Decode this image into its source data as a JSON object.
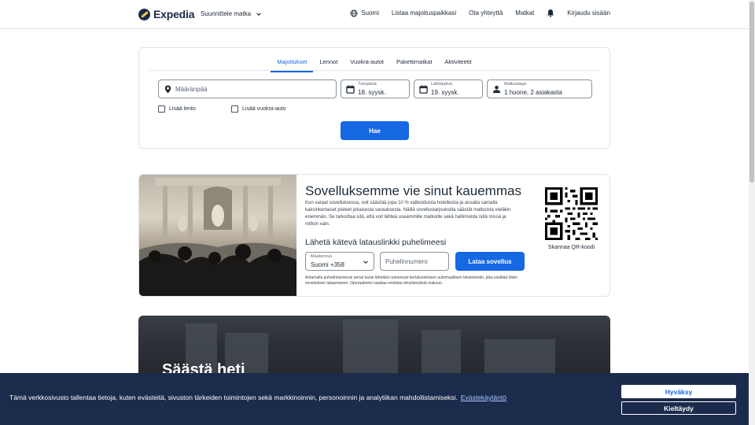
{
  "header": {
    "logo_text": "Expedia",
    "plan_trip": "Suunnittele matka",
    "nav": {
      "language": "Suomi",
      "list_property": "Listaa majoituspaikkasi",
      "contact": "Ota yhteyttä",
      "trips": "Matkat",
      "sign_in": "Kirjaudu sisään"
    }
  },
  "search": {
    "tabs": [
      "Majoitukset",
      "Lennot",
      "Vuokra-autot",
      "Pakettimatkat",
      "Aktiviteetit"
    ],
    "active_tab": "Majoitukset",
    "destination_placeholder": "Määränpää",
    "checkin_label": "Tulopäivä",
    "checkin_value": "18. syysk.",
    "checkout_label": "Lähtöpäivä",
    "checkout_value": "19. syysk.",
    "travelers_label": "Matkustajat",
    "travelers_value": "1 huone, 2 asiakasta",
    "add_flight": "Lisää lento",
    "add_car": "Lisää vuokra-auto",
    "search_button": "Hae"
  },
  "promo": {
    "title": "Sovelluksemme vie sinut kauemmas",
    "text": "Kun varaat sovelluksessa, voit säästää jopa 10 % valikoiduista hotelleista ja ansaita samalla kaksinkertaiset pisteet jokaisesta varauksesta. Näillä sovellustarjouksilla säästät matkoista vieläkin enemmän. Se tarkoittaa sitä, että voit lähteä useammille matkoille sekä hallinnoida niitä missä ja milloin vain.",
    "subtitle": "Lähetä kätevä latauslinkki puhelimeesi",
    "country_label": "Maatunnus",
    "country_value": "Suomi +358",
    "phone_placeholder": "Puhelinnumero",
    "download_button": "Lataa sovellus",
    "disclaimer": "Antamalla puhelinnumerosi annat luvan lähettää numeroosi kertaluonteisen automaattisen tekstiviestin, joka sisältää linkin sovelluksen lataamiseen. Operaattorisi saattaa veloittaa tekstiviestistä maksun.",
    "qr_label": "Skannaa QR-koodi"
  },
  "save_banner": {
    "title": "Säästä heti"
  },
  "cookie": {
    "text": "Tämä verkkosivusto tallentaa tietoja, kuten evästeitä, sivuston tärkeiden toimintojen sekä markkinoinnin, personoinnin ja analytiikan mahdollistamiseksi.",
    "link": "Evästekäytäntö",
    "accept": "Hyväksy",
    "reject": "Kieltäydy"
  },
  "colors": {
    "brand_blue": "#1668e3",
    "navy": "#1b2b4b",
    "logo_yellow": "#ffc94c"
  }
}
